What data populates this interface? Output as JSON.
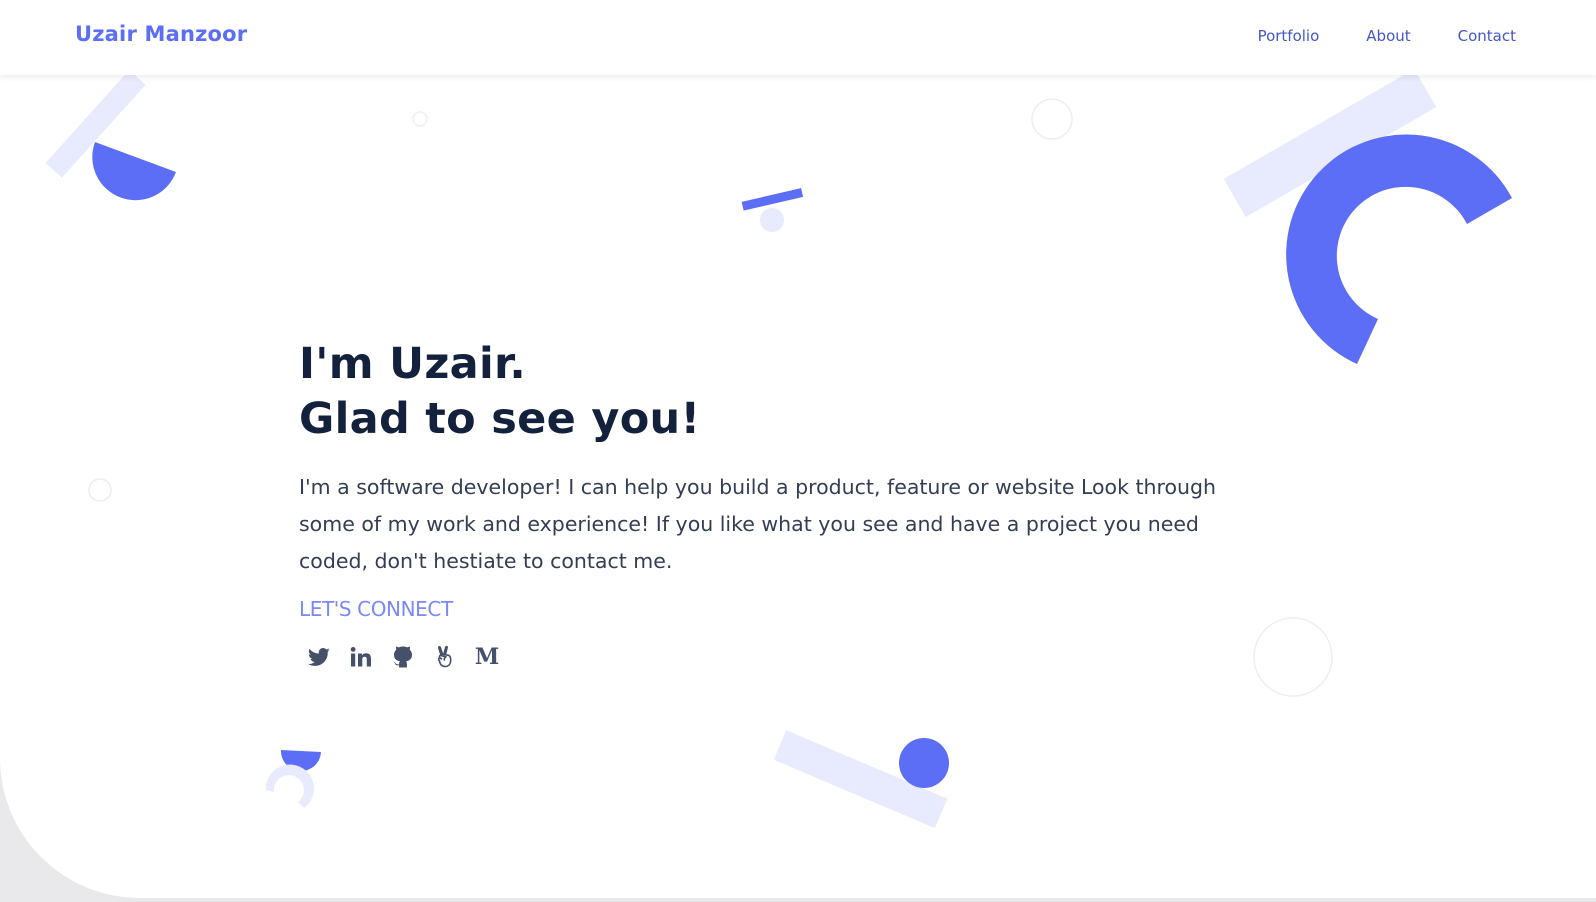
{
  "header": {
    "brand": "Uzair Manzoor",
    "nav": [
      "Portfolio",
      "About",
      "Contact"
    ]
  },
  "hero": {
    "heading_line1": "I'm Uzair.",
    "heading_line2": "Glad to see you!",
    "description": "I'm a software developer! I can help you build a product, feature or website Look through some of my work and experience! If you like what you see and have a project you need coded, don't hestiate to contact me.",
    "connect_label": "LET'S CONNECT"
  },
  "socials": [
    {
      "icon": "twitter-icon"
    },
    {
      "icon": "linkedin-icon"
    },
    {
      "icon": "github-icon"
    },
    {
      "icon": "angellist-icon"
    },
    {
      "icon": "medium-icon",
      "glyph": "M"
    }
  ],
  "colors": {
    "accent": "#5b6ef5",
    "accent_light": "#e8eafd",
    "heading": "#14213d",
    "body_text": "#333d54",
    "connect": "#7b88f7"
  }
}
